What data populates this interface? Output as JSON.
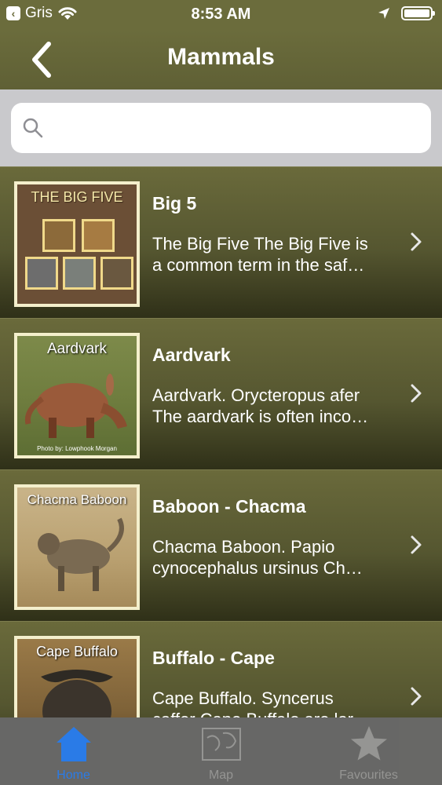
{
  "status_bar": {
    "carrier": "Gris",
    "time": "8:53 AM"
  },
  "nav": {
    "title": "Mammals"
  },
  "search": {
    "placeholder": ""
  },
  "items": [
    {
      "title": "Big 5",
      "desc_line1": "The Big Five The Big Five is",
      "desc_line2": "a common term in the saf…",
      "thumb_caption": "THE BIG FIVE"
    },
    {
      "title": "Aardvark",
      "desc_line1": "Aardvark. Orycteropus afer",
      "desc_line2": "The aardvark is often inco…",
      "thumb_caption": "Aardvark",
      "thumb_credit": "Photo by: Lowphook Morgan"
    },
    {
      "title": "Baboon - Chacma",
      "desc_line1": "Chacma Baboon. Papio",
      "desc_line2": "cynocephalus ursinus Ch…",
      "thumb_caption": "Chacma Baboon"
    },
    {
      "title": "Buffalo - Cape",
      "desc_line1": "Cape Buffalo. Syncerus",
      "desc_line2": "caffer Cape Buffalo are lar…",
      "thumb_caption": "Cape Buffalo"
    }
  ],
  "tabs": [
    {
      "label": "Home",
      "icon": "home-icon",
      "active": true
    },
    {
      "label": "Map",
      "icon": "map-icon",
      "active": false
    },
    {
      "label": "Favourites",
      "icon": "star-icon",
      "active": false
    }
  ],
  "colors": {
    "nav_bg": "#6b6c3c",
    "tab_active": "#2a7ff2",
    "tab_inactive": "#9a9a9a"
  }
}
